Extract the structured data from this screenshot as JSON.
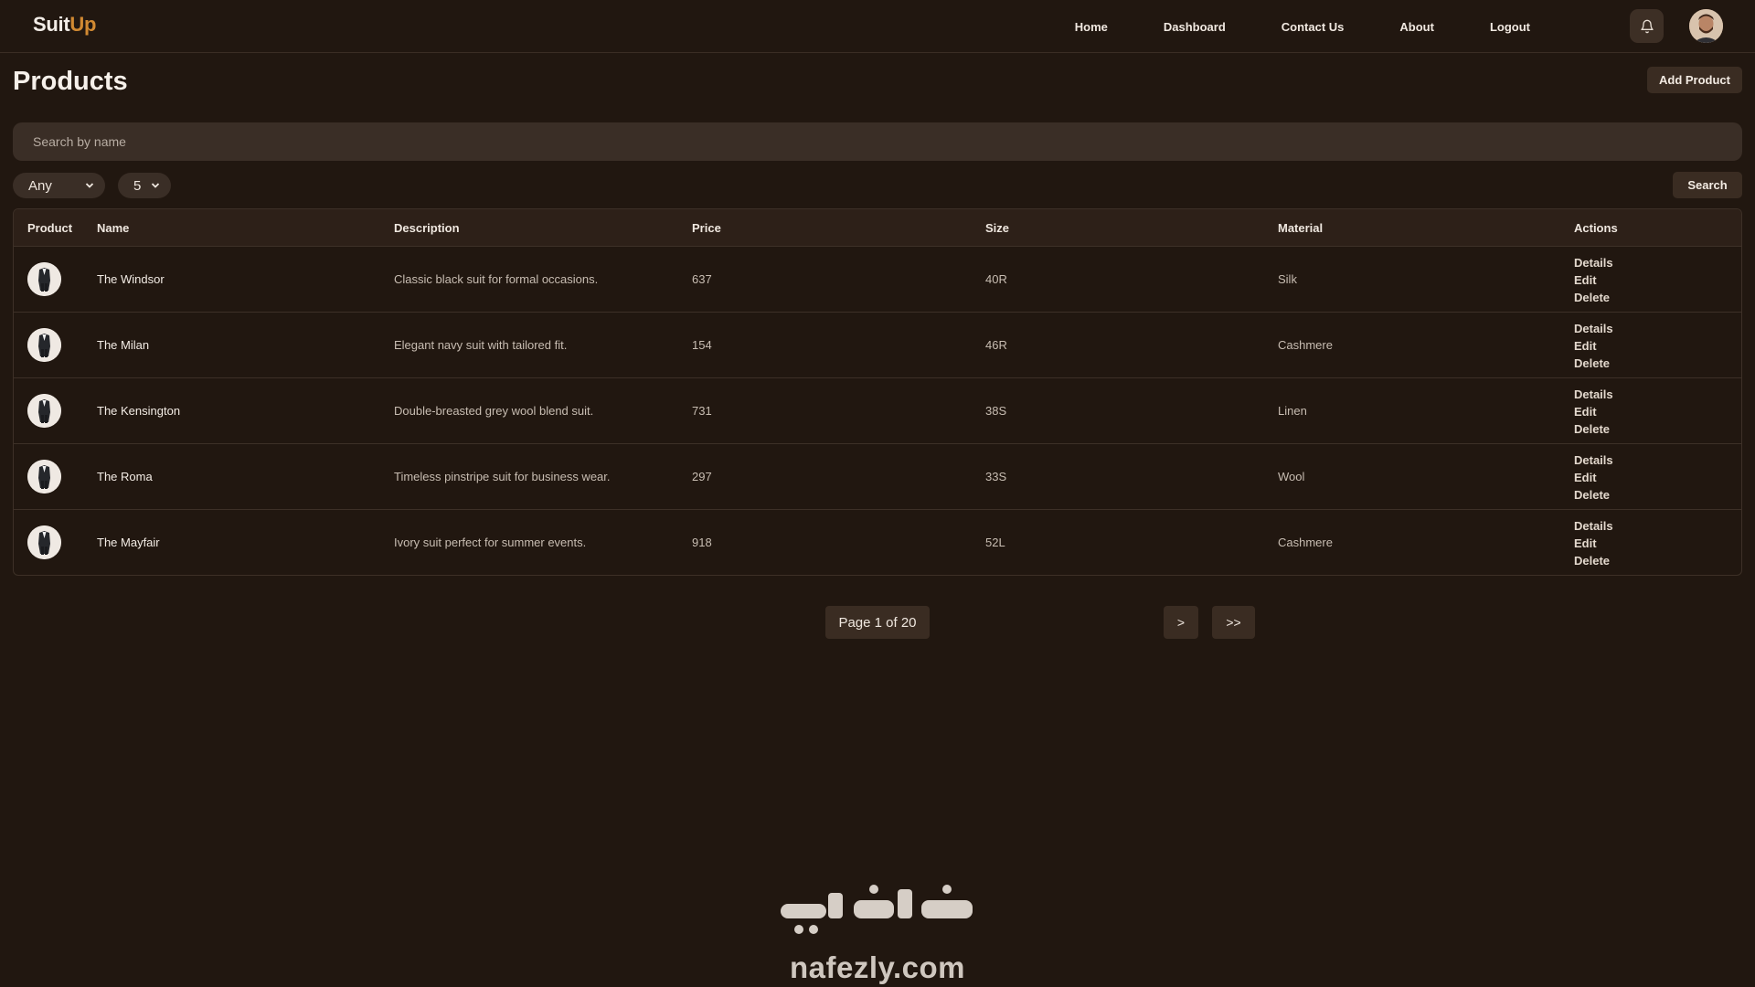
{
  "brand": {
    "first": "Suit",
    "second": "Up",
    "accent": "#d28a32"
  },
  "nav": {
    "home": "Home",
    "dashboard": "Dashboard",
    "contact": "Contact Us",
    "about": "About",
    "logout": "Logout"
  },
  "icons": {
    "notifications": "bell-icon",
    "profile": "avatar",
    "product": "suit-icon"
  },
  "page": {
    "title": "Products",
    "add_label": "Add Product"
  },
  "search": {
    "placeholder": "Search by name",
    "button": "Search"
  },
  "filters": {
    "category": "Any",
    "per_page": "5"
  },
  "table": {
    "headers": {
      "product": "Product",
      "name": "Name",
      "description": "Description",
      "price": "Price",
      "size": "Size",
      "material": "Material",
      "actions": "Actions"
    },
    "action_labels": {
      "details": "Details",
      "edit": "Edit",
      "delete": "Delete"
    },
    "rows": [
      {
        "name": "The Windsor",
        "description": "Classic black suit for formal occasions.",
        "price": "637",
        "size": "40R",
        "material": "Silk"
      },
      {
        "name": "The Milan",
        "description": "Elegant navy suit with tailored fit.",
        "price": "154",
        "size": "46R",
        "material": "Cashmere"
      },
      {
        "name": "The Kensington",
        "description": "Double-breasted grey wool blend suit.",
        "price": "731",
        "size": "38S",
        "material": "Linen"
      },
      {
        "name": "The Roma",
        "description": "Timeless pinstripe suit for business wear.",
        "price": "297",
        "size": "33S",
        "material": "Wool"
      },
      {
        "name": "The Mayfair",
        "description": "Ivory suit perfect for summer events.",
        "price": "918",
        "size": "52L",
        "material": "Cashmere"
      }
    ]
  },
  "pagination": {
    "label": "Page 1 of 20",
    "next": ">",
    "last": ">>"
  },
  "watermark": {
    "arabic": "نفذلي",
    "url": "nafezly.com"
  }
}
